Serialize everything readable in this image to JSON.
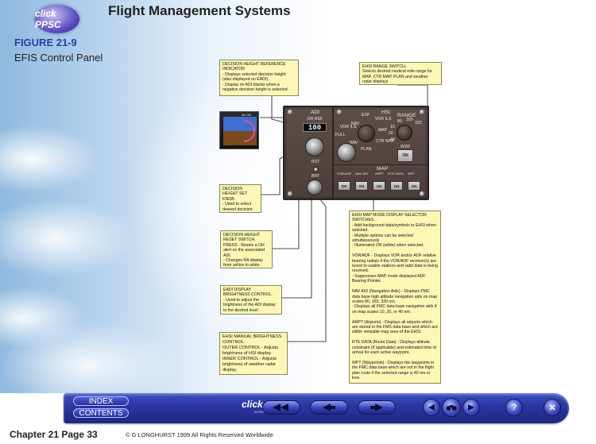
{
  "header": {
    "logo": "click PPSC",
    "title": "Flight Management Systems",
    "figure_number": "FIGURE 21-9",
    "figure_title": "EFIS Control Panel"
  },
  "callouts": {
    "dh_reference": {
      "title": "DECISION HEIGHT REFERENCE INDICATOR",
      "lines": [
        "- Displays selected decision height (also displayed on EADI).",
        "- Display on ADI blanks when a negative decision height is selected"
      ]
    },
    "ehsi_range": {
      "title": "EHSI RANGE SWITCH.",
      "lines": [
        "Selects desired nautical mile range for MAP, CTR MAP, PLAN and weather radar displays"
      ]
    },
    "dh_set_knob": {
      "title": "DECISION HEIGHT SET KNOB.",
      "lines": [
        "- Used to select desired decision height for DH desting"
      ]
    },
    "dh_reset": {
      "title": "DECISION HEIGHT RESET SWITCH.",
      "lines": [
        "PRESS - Resets a DH alert on the associated ADI.",
        "- Changes RA display from yellow to white."
      ]
    },
    "eadi_brightness": {
      "title": "EADI DISPLAY BRIGHTNESS CONTROL.",
      "lines": [
        "- Used to adjust the brightness of the ADI display to the desired level."
      ]
    },
    "ehsi_brightness": {
      "title": "EHSI MANUAL BRIGHTNESS CONTROL.",
      "lines": [
        "OUTER CONTROL - Adjusts brightness of HSI display.",
        "INNER CONTROL - Adjusts brightness of weather radar display."
      ]
    },
    "ehsi_map_mode": {
      "title": "EHSI MAP MODE DISPLAY SELECTOR SWITCHES.",
      "lines": [
        "- Add background data/symbols to EHSI when selected.",
        "- Multiple options can be selected simultaneously.",
        "- Illuminated ON (white) when selected.",
        "",
        "VOR/ADF - Displays VOR and/or ADF relative bearing radials if the VOR/ADF receiver(s) are tuned to usable stations and valid data is being received.",
        "- Suppresses MAP mode displayed ADF Bearing Pointer.",
        "",
        "NAV AID (Navigation Aids) - Displays FMC data base high altitude navigation aids on map scales 80, 160, 320 nm.",
        "- Displays all FMC data base navigation aids if on map scales 10, 20, or 40 nm.",
        "",
        "ARPT (Airports) - Displays all airports which are stored in the FMS data base and which are within viewable map area of the EHSI.",
        "",
        "RTE DATA (Route Data) - Displays altitude constraint (if applicable) and estimated time of arrival for each active waypoint.",
        "",
        "WPT (Waypoints) - Displays the waypoints in the FMC data base which are not in the flight plan route if the selected range is 40 nm or less."
      ]
    }
  },
  "panel": {
    "adi_label": "ADI",
    "dh_ref_label": "DH REF",
    "dh_value": "100",
    "rst_label": "RST",
    "brt_label": "BRT",
    "hsi_label": "HSI",
    "range_label": "RANGE",
    "mode_labels": [
      "EXP",
      "VOR ILS",
      "NAV",
      "MAP",
      "PLAN",
      "CTR MAP",
      "FULL",
      "VOR ILS",
      "NAV"
    ],
    "range_labels": [
      "10",
      "20",
      "40",
      "80",
      "160",
      "320"
    ],
    "wxr_label": "WXR",
    "wxr_button": "ON",
    "map_label": "MAP",
    "map_buttons": [
      {
        "label": "VOR/ADF",
        "state": "ON"
      },
      {
        "label": "NAV AID",
        "state": "ON"
      },
      {
        "label": "ARPT",
        "state": "ON"
      },
      {
        "label": "RTE DATA",
        "state": "ON"
      },
      {
        "label": "WPT",
        "state": "ON"
      }
    ]
  },
  "adi_thumbnail": {
    "dh_text": "DH 100"
  },
  "nav": {
    "index_label": "INDEX",
    "contents_label": "CONTENTS",
    "brand": "click PPSC",
    "brand_sub": "INTERACTIVE LEARNING",
    "rewind_icon": "double-left-arrow",
    "back_icon": "left-arrow",
    "forward_icon": "right-arrow",
    "help_label": "?",
    "close_label": "✕"
  },
  "footer": {
    "chapter": "Chapter 21  Page 33",
    "copyright": "© G LONGHURST  1999  All Rights Reserved Worldwide"
  },
  "colors": {
    "callout_bg": "#fdf7b6",
    "nav_blue": "#2b38a3",
    "figure_blue": "#2a3fa8",
    "panel_brown": "#5e4e49"
  }
}
